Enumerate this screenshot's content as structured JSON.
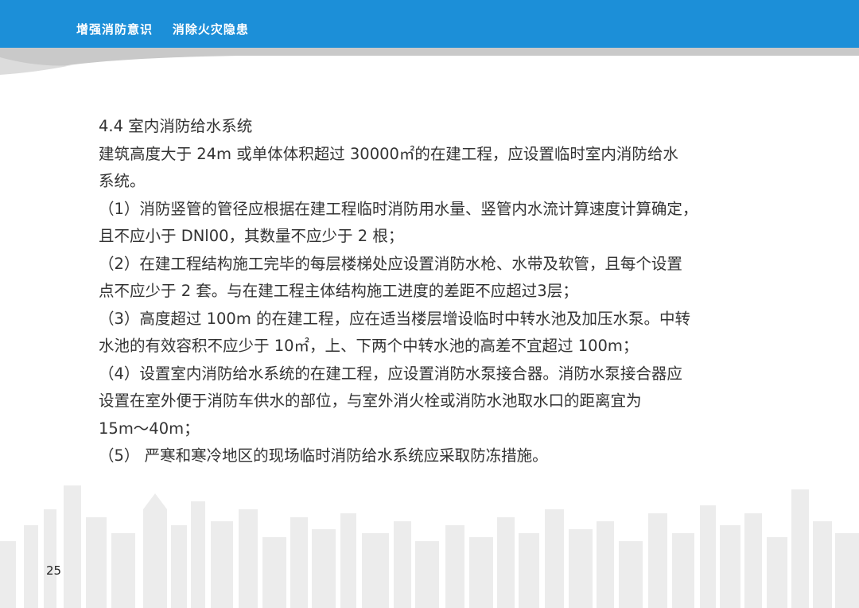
{
  "header": {
    "title": "增强消防意识    消除火灾隐患"
  },
  "content": {
    "lines": [
      "4.4 室内消防给水系统",
      "建筑高度大于 24m 或单体体积超过 30000㎡的在建工程，应设置临时室内消防给水",
      "系统。",
      "（1）消防竖管的管径应根据在建工程临时消防用水量、竖管内水流计算速度计算确定，",
      "且不应小于 DNl00，其数量不应少于 2 根；",
      "（2）在建工程结构施工完毕的每层楼梯处应设置消防水枪、水带及软管，且每个设置",
      "点不应少于 2 套。与在建工程主体结构施工进度的差距不应超过3层；",
      "（3）高度超过 100m 的在建工程，应在适当楼层增设临时中转水池及加压水泵。中转",
      "水池的有效容积不应少于 10㎡，上、下两个中转水池的高差不宜超过 100m；",
      "（4）设置室内消防给水系统的在建工程，应设置消防水泵接合器。消防水泵接合器应",
      "设置在室外便于消防车供水的部位，与室外消火栓或消防水池取水口的距离宜为",
      "15m～40m；",
      "（5） 严寒和寒冷地区的现场临时消防给水系统应采取防冻措施。"
    ]
  },
  "footer": {
    "page_number": "25"
  },
  "colors": {
    "header_blue": "#1c8fd8",
    "swoosh_gray": "#c9c9c9",
    "skyline_gray": "#ececec"
  }
}
